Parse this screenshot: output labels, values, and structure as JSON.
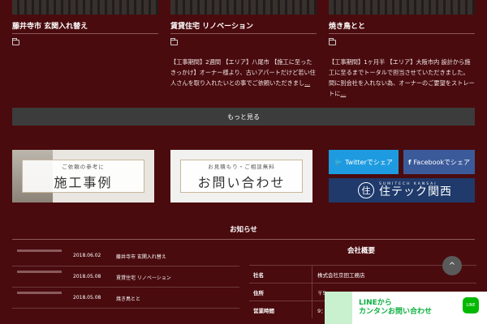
{
  "works": [
    {
      "title": "藤井寺市 玄関入れ替え",
      "desc": "",
      "more": ""
    },
    {
      "title": "賃貸住宅 リノベーション",
      "desc": "【工事期間】2週間 【エリア】八尾市 【施工に至ったきっかけ】オーナー様より、古いアパートだけど若い住人さんを取り入れたいとの事でご依頼いただきまし",
      "more": "..."
    },
    {
      "title": "焼き鳥とと",
      "desc": "【工事期間】1ヶ月半 【エリア】大阪市内 設計から施工に至るまでトータルで担当させていただきました。 間に別会社を入れない為、オーナーのご要望をストレートに",
      "more": "..."
    }
  ],
  "first_desc": "【工事期間】2週間 【エリア】",
  "more_button": "もっと見る",
  "banners": {
    "works_sub": "ご依頼の参考に",
    "works_main": "施工事例",
    "contact_sub": "お見積もり・ご相談無料",
    "contact_main": "お問い合わせ"
  },
  "share": {
    "twitter": "Twitterでシェア",
    "facebook": "Facebookでシェア"
  },
  "logo": {
    "en": "SUMITECH KANSAI",
    "jp": "住テック関西",
    "mark": "住"
  },
  "news": {
    "title": "お知らせ",
    "items": [
      {
        "date": "2018.06.02",
        "text": "藤井寺市 玄関入れ替え"
      },
      {
        "date": "2018.05.08",
        "text": "賃貸住宅 リノベーション"
      },
      {
        "date": "2018.05.08",
        "text": "焼き鳥とと"
      }
    ]
  },
  "company": {
    "title": "会社概要",
    "rows": [
      {
        "k": "社名",
        "v": "株式会社京田工務店"
      },
      {
        "k": "住所",
        "v": "〒5"
      },
      {
        "k": "営業時間",
        "v": "9："
      }
    ]
  },
  "line_banner": {
    "line1": "LINEから",
    "line2": "カンタンお問い合わせ",
    "icon": "LINE"
  },
  "top_button": "^"
}
